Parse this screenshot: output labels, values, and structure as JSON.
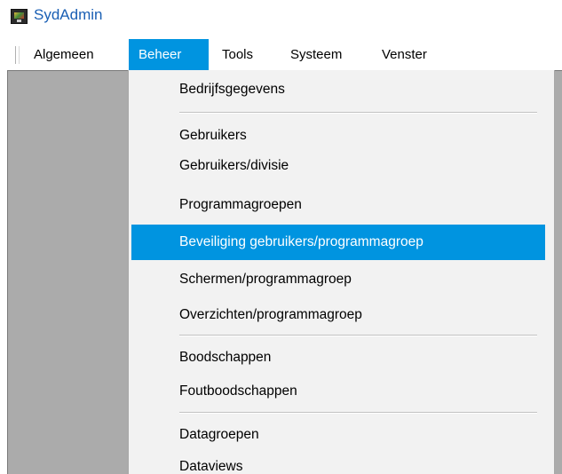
{
  "app": {
    "title": "SydAdmin",
    "icon": "app-monitor-icon"
  },
  "menubar": {
    "items": [
      {
        "label": "Algemeen",
        "active": false
      },
      {
        "label": "Beheer",
        "active": true
      },
      {
        "label": "Tools",
        "active": false
      },
      {
        "label": "Systeem",
        "active": false
      },
      {
        "label": "Venster",
        "active": false
      }
    ]
  },
  "dropdown": {
    "items": [
      {
        "label": "Bedrijfsgegevens"
      },
      {
        "label": "Gebruikers"
      },
      {
        "label": "Gebruikers/divisie"
      },
      {
        "label": "Programmagroepen"
      },
      {
        "label": "Beveiliging gebruikers/programmagroep",
        "highlighted": true
      },
      {
        "label": "Schermen/programmagroep"
      },
      {
        "label": "Overzichten/programmagroep"
      },
      {
        "label": "Boodschappen"
      },
      {
        "label": "Foutboodschappen"
      },
      {
        "label": "Datagroepen"
      },
      {
        "label": "Dataviews"
      }
    ]
  },
  "colors": {
    "accent": "#0094e0",
    "title": "#1a5fb4",
    "workspace": "#ababab",
    "menu_bg": "#f2f2f2"
  }
}
